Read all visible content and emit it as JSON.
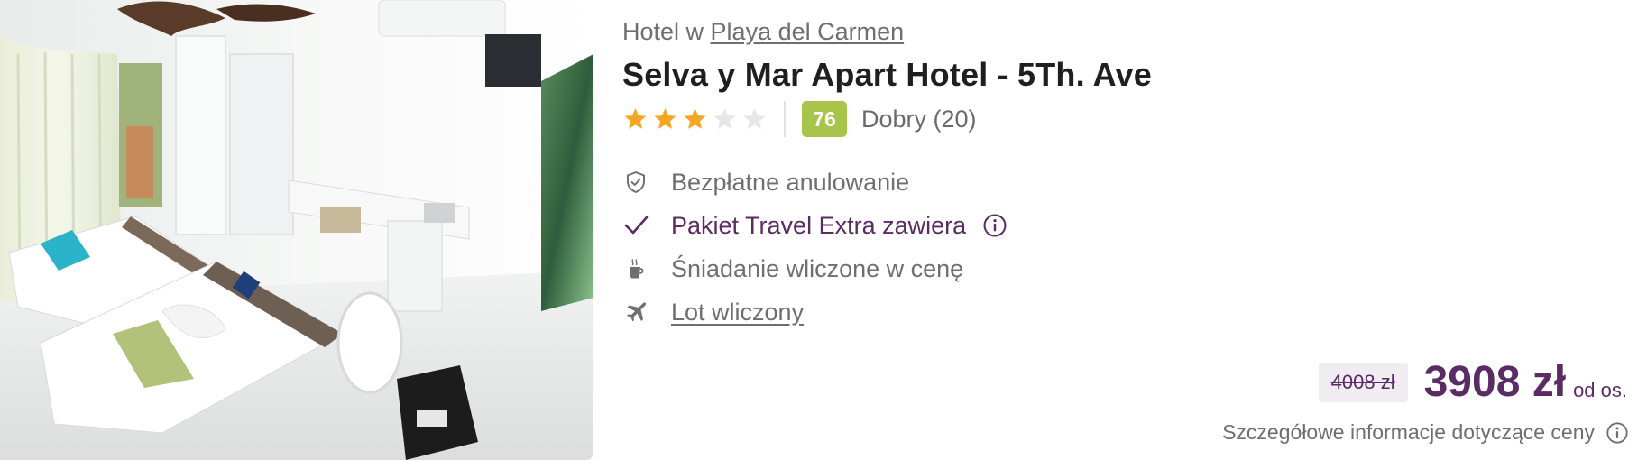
{
  "location": {
    "prefix": "Hotel w",
    "city": "Playa del Carmen"
  },
  "hotel": {
    "name": "Selva y Mar Apart Hotel - 5Th. Ave",
    "stars_filled": 3,
    "stars_total": 5
  },
  "rating": {
    "score": "76",
    "label": "Dobry (20)"
  },
  "features": {
    "cancellation": "Bezpłatne anulowanie",
    "travel_extra": "Pakiet Travel Extra zawiera",
    "breakfast": "Śniadanie wliczone w cenę",
    "flight": "Lot wliczony"
  },
  "price": {
    "old": "4008 zł",
    "current": "3908 zł",
    "per": "od os.",
    "details": "Szczegółowe informacje dotyczące ceny"
  },
  "colors": {
    "accent": "#5b2b63",
    "score_badge": "#a8c44b",
    "star_filled": "#f5a623",
    "star_empty": "#e6e6e6"
  },
  "icons": {
    "cancellation": "shield-check-icon",
    "travel_extra": "checkmark-icon",
    "breakfast": "coffee-cup-icon",
    "flight": "airplane-icon",
    "info": "info-icon",
    "star": "star-icon"
  }
}
